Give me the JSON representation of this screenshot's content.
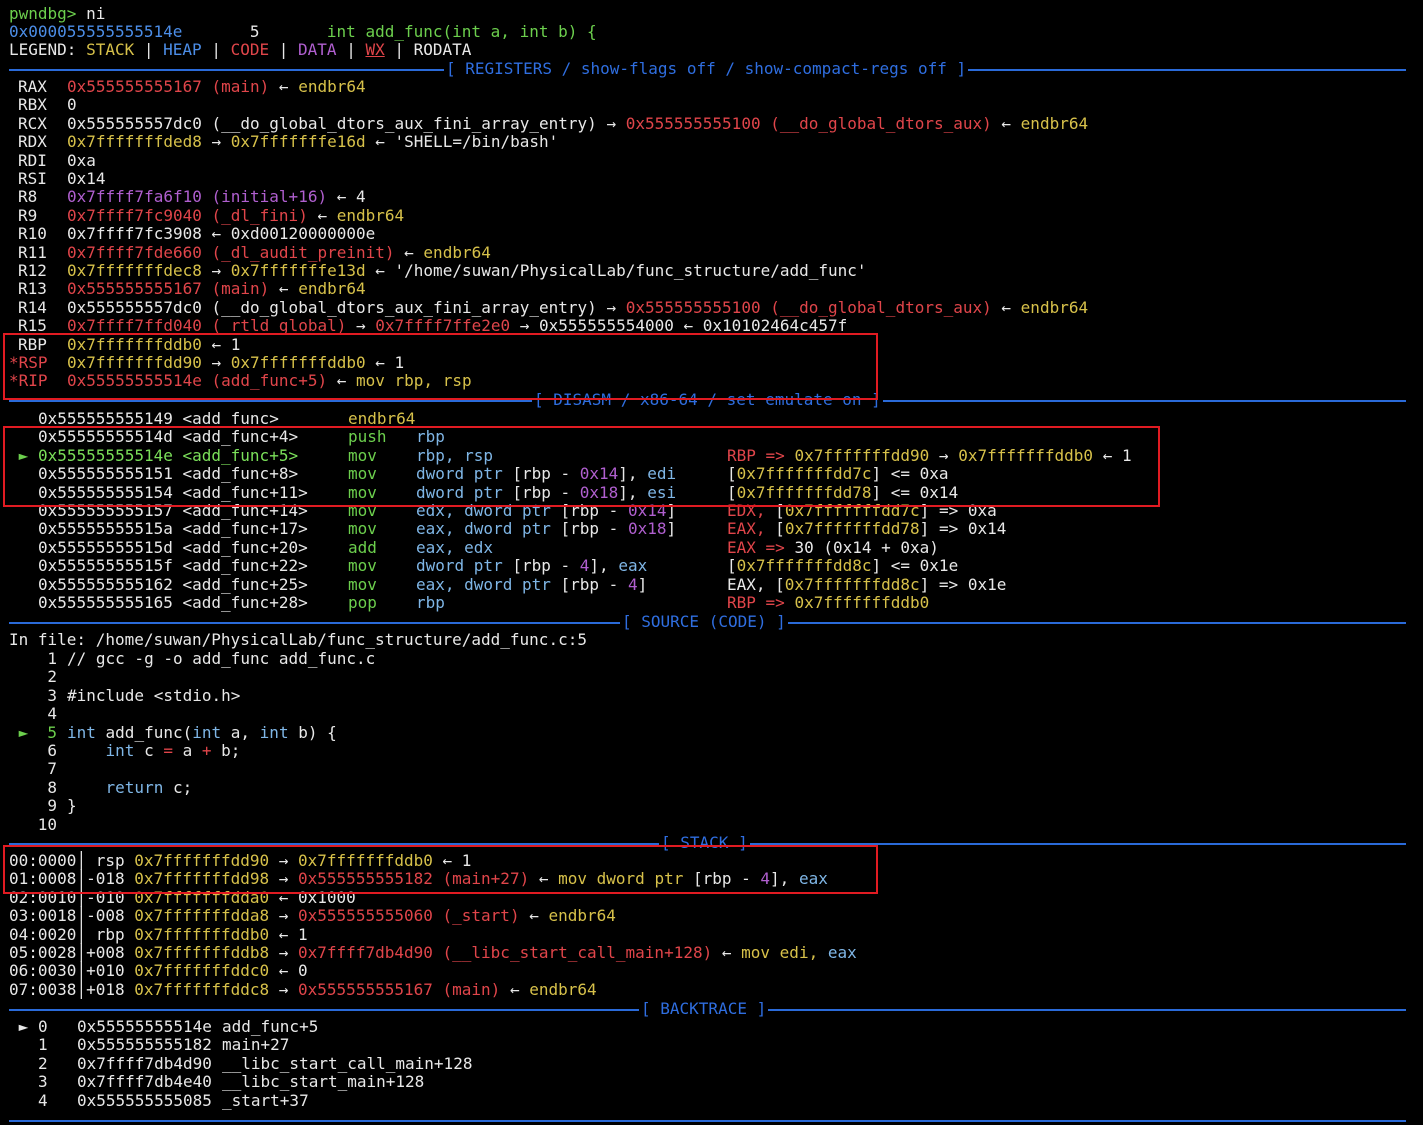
{
  "prompt": {
    "name": "pwndbg>",
    "command": "ni"
  },
  "ctx_line": {
    "addr": "0x000055555555514e",
    "line_no": "5",
    "src": "int add_func(int a, int b) {"
  },
  "legend": {
    "label": "LEGEND:",
    "items": [
      "STACK",
      "HEAP",
      "CODE",
      "DATA",
      "WX",
      "RODATA"
    ]
  },
  "sections": {
    "registers": "[ REGISTERS / show-flags off / show-compact-regs off ]",
    "disasm": "[ DISASM / x86-64 / set emulate on ]",
    "source": "[ SOURCE (CODE) ]",
    "stack": "[ STACK ]",
    "backtrace": "[ BACKTRACE ]"
  },
  "registers": [
    {
      "name": "RAX",
      "parts": [
        [
          "0x555555555167 (main)",
          "red"
        ],
        [
          " ← ",
          "white"
        ],
        [
          "endbr64",
          "yellow"
        ]
      ]
    },
    {
      "name": "RBX",
      "parts": [
        [
          "0",
          "white"
        ]
      ]
    },
    {
      "name": "RCX",
      "parts": [
        [
          "0x555555557dc0 (__do_global_dtors_aux_fini_array_entry)",
          "white"
        ],
        [
          " → ",
          "white"
        ],
        [
          "0x555555555100 (__do_global_dtors_aux)",
          "red"
        ],
        [
          " ← ",
          "white"
        ],
        [
          "endbr64",
          "yellow"
        ]
      ]
    },
    {
      "name": "RDX",
      "parts": [
        [
          "0x7fffffffded8",
          "yellow"
        ],
        [
          " → ",
          "white"
        ],
        [
          "0x7fffffffe16d",
          "yellow"
        ],
        [
          " ← 'SHELL=/bin/bash'",
          "white"
        ]
      ]
    },
    {
      "name": "RDI",
      "parts": [
        [
          "0xa",
          "white"
        ]
      ]
    },
    {
      "name": "RSI",
      "parts": [
        [
          "0x14",
          "white"
        ]
      ]
    },
    {
      "name": "R8",
      "parts": [
        [
          "0x7ffff7fa6f10 (initial+16)",
          "purple"
        ],
        [
          " ← 4",
          "white"
        ]
      ]
    },
    {
      "name": "R9",
      "parts": [
        [
          "0x7ffff7fc9040 (_dl_fini)",
          "red"
        ],
        [
          " ← ",
          "white"
        ],
        [
          "endbr64",
          "yellow"
        ]
      ]
    },
    {
      "name": "R10",
      "parts": [
        [
          "0x7ffff7fc3908 ← 0xd00120000000e",
          "white"
        ]
      ]
    },
    {
      "name": "R11",
      "parts": [
        [
          "0x7ffff7fde660 (_dl_audit_preinit)",
          "red"
        ],
        [
          " ← ",
          "white"
        ],
        [
          "endbr64",
          "yellow"
        ]
      ]
    },
    {
      "name": "R12",
      "parts": [
        [
          "0x7fffffffdec8",
          "yellow"
        ],
        [
          " → ",
          "white"
        ],
        [
          "0x7fffffffe13d",
          "yellow"
        ],
        [
          " ← '/home/suwan/PhysicalLab/func_structure/add_func'",
          "white"
        ]
      ]
    },
    {
      "name": "R13",
      "parts": [
        [
          "0x555555555167 (main)",
          "red"
        ],
        [
          " ← ",
          "white"
        ],
        [
          "endbr64",
          "yellow"
        ]
      ]
    },
    {
      "name": "R14",
      "parts": [
        [
          "0x555555557dc0 (__do_global_dtors_aux_fini_array_entry)",
          "white"
        ],
        [
          " → ",
          "white"
        ],
        [
          "0x555555555100 (__do_global_dtors_aux)",
          "red"
        ],
        [
          " ← ",
          "white"
        ],
        [
          "endbr64",
          "yellow"
        ]
      ]
    },
    {
      "name": "R15",
      "parts": [
        [
          "0x7ffff7ffd040 (_rtld_global)",
          "red"
        ],
        [
          " → ",
          "white"
        ],
        [
          "0x7ffff7ffe2e0",
          "red"
        ],
        [
          " → 0x555555554000 ← 0x10102464c457f",
          "white"
        ]
      ]
    },
    {
      "name": "RBP",
      "parts": [
        [
          "0x7fffffffddb0",
          "yellow"
        ],
        [
          " ← 1",
          "white"
        ]
      ]
    },
    {
      "name": "*RSP",
      "parts": [
        [
          "0x7fffffffdd90",
          "yellow"
        ],
        [
          " → ",
          "white"
        ],
        [
          "0x7fffffffddb0",
          "yellow"
        ],
        [
          " ← 1",
          "white"
        ]
      ]
    },
    {
      "name": "*RIP",
      "parts": [
        [
          "0x55555555514e (add_func+5)",
          "red"
        ],
        [
          " ← ",
          "white"
        ],
        [
          "mov rbp, rsp",
          "yellow"
        ]
      ]
    }
  ],
  "disasm": [
    {
      "cur": false,
      "addr": "0x555555555149 <add_func>",
      "mn": "endbr64",
      "ops": [],
      "cmt": []
    },
    {
      "cur": false,
      "addr": "0x55555555514d <add_func+4>",
      "mn": "push",
      "ops": [
        [
          "rbp",
          "cyan"
        ]
      ],
      "cmt": []
    },
    {
      "cur": true,
      "addr": "0x55555555514e <add_func+5>",
      "mn": "mov",
      "ops": [
        [
          "rbp, rsp",
          "cyan"
        ]
      ],
      "cmt": [
        [
          "RBP => ",
          "red"
        ],
        [
          "0x7fffffffdd90",
          "yellow"
        ],
        [
          " → ",
          "white"
        ],
        [
          "0x7fffffffddb0",
          "yellow"
        ],
        [
          " ← 1",
          "white"
        ]
      ]
    },
    {
      "cur": false,
      "addr": "0x555555555151 <add_func+8>",
      "mn": "mov",
      "ops": [
        [
          "dword ptr ",
          "cyan"
        ],
        [
          "[rbp - ",
          "white"
        ],
        [
          "0x14",
          "purple"
        ],
        [
          "], ",
          "white"
        ],
        [
          "edi",
          "cyan"
        ]
      ],
      "cmt": [
        [
          "[",
          "white"
        ],
        [
          "0x7fffffffdd7c",
          "yellow"
        ],
        [
          "] <= 0xa",
          "white"
        ]
      ]
    },
    {
      "cur": false,
      "addr": "0x555555555154 <add_func+11>",
      "mn": "mov",
      "ops": [
        [
          "dword ptr ",
          "cyan"
        ],
        [
          "[rbp - ",
          "white"
        ],
        [
          "0x18",
          "purple"
        ],
        [
          "], ",
          "white"
        ],
        [
          "esi",
          "cyan"
        ]
      ],
      "cmt": [
        [
          "[",
          "white"
        ],
        [
          "0x7fffffffdd78",
          "yellow"
        ],
        [
          "] <= 0x14",
          "white"
        ]
      ]
    },
    {
      "cur": false,
      "addr": "0x555555555157 <add_func+14>",
      "mn": "mov",
      "ops": [
        [
          "edx, dword ptr ",
          "cyan"
        ],
        [
          "[rbp - ",
          "white"
        ],
        [
          "0x14",
          "purple"
        ],
        [
          "]",
          "white"
        ]
      ],
      "cmt": [
        [
          "EDX, ",
          "red"
        ],
        [
          "[",
          "white"
        ],
        [
          "0x7fffffffdd7c",
          "yellow"
        ],
        [
          "] => 0xa",
          "white"
        ]
      ]
    },
    {
      "cur": false,
      "addr": "0x55555555515a <add_func+17>",
      "mn": "mov",
      "ops": [
        [
          "eax, dword ptr ",
          "cyan"
        ],
        [
          "[rbp - ",
          "white"
        ],
        [
          "0x18",
          "purple"
        ],
        [
          "]",
          "white"
        ]
      ],
      "cmt": [
        [
          "EAX, ",
          "red"
        ],
        [
          "[",
          "white"
        ],
        [
          "0x7fffffffdd78",
          "yellow"
        ],
        [
          "] => 0x14",
          "white"
        ]
      ]
    },
    {
      "cur": false,
      "addr": "0x55555555515d <add_func+20>",
      "mn": "add",
      "ops": [
        [
          "eax, edx",
          "cyan"
        ]
      ],
      "cmt": [
        [
          "EAX => ",
          "red"
        ],
        [
          "30 (0x14 + 0xa)",
          "white"
        ]
      ]
    },
    {
      "cur": false,
      "addr": "0x55555555515f <add_func+22>",
      "mn": "mov",
      "ops": [
        [
          "dword ptr ",
          "cyan"
        ],
        [
          "[rbp - ",
          "white"
        ],
        [
          "4",
          "purple"
        ],
        [
          "], ",
          "white"
        ],
        [
          "eax",
          "cyan"
        ]
      ],
      "cmt": [
        [
          "[",
          "white"
        ],
        [
          "0x7fffffffdd8c",
          "yellow"
        ],
        [
          "] <= 0x1e",
          "white"
        ]
      ]
    },
    {
      "cur": false,
      "addr": "0x555555555162 <add_func+25>",
      "mn": "mov",
      "ops": [
        [
          "eax, dword ptr ",
          "cyan"
        ],
        [
          "[rbp - ",
          "white"
        ],
        [
          "4",
          "purple"
        ],
        [
          "]",
          "white"
        ]
      ],
      "cmt": [
        [
          "EAX, [",
          "white"
        ],
        [
          "0x7fffffffdd8c",
          "yellow"
        ],
        [
          "] => 0x1e",
          "white"
        ]
      ]
    },
    {
      "cur": false,
      "addr": "0x555555555165 <add_func+28>",
      "mn": "pop",
      "ops": [
        [
          "rbp",
          "cyan"
        ]
      ],
      "cmt": [
        [
          "RBP => ",
          "red"
        ],
        [
          "0x7fffffffddb0",
          "yellow"
        ]
      ]
    }
  ],
  "source": {
    "file_line": "In file: /home/suwan/PhysicalLab/func_structure/add_func.c:5",
    "lines": [
      {
        "n": "1",
        "cur": false,
        "parts": [
          [
            "// gcc -g -o add_func add_func.c",
            "white"
          ]
        ]
      },
      {
        "n": "2",
        "cur": false,
        "parts": []
      },
      {
        "n": "3",
        "cur": false,
        "parts": [
          [
            "#include <stdio.h>",
            "white"
          ]
        ]
      },
      {
        "n": "4",
        "cur": false,
        "parts": []
      },
      {
        "n": "5",
        "cur": true,
        "parts": [
          [
            "int",
            "cyan"
          ],
          [
            " add_func(",
            "white"
          ],
          [
            "int",
            "cyan"
          ],
          [
            " a, ",
            "white"
          ],
          [
            "int",
            "cyan"
          ],
          [
            " b) {",
            "white"
          ]
        ]
      },
      {
        "n": "6",
        "cur": false,
        "parts": [
          [
            "    ",
            "white"
          ],
          [
            "int",
            "cyan"
          ],
          [
            " c ",
            "white"
          ],
          [
            "=",
            "red"
          ],
          [
            " a ",
            "white"
          ],
          [
            "+",
            "red"
          ],
          [
            " b;",
            "white"
          ]
        ]
      },
      {
        "n": "7",
        "cur": false,
        "parts": []
      },
      {
        "n": "8",
        "cur": false,
        "parts": [
          [
            "    ",
            "white"
          ],
          [
            "return",
            "cyan"
          ],
          [
            " c;",
            "white"
          ]
        ]
      },
      {
        "n": "9",
        "cur": false,
        "parts": [
          [
            "}",
            "white"
          ]
        ]
      },
      {
        "n": "10",
        "cur": false,
        "parts": []
      }
    ]
  },
  "stack": [
    {
      "idx": "00:0000",
      "off": " rsp",
      "parts": [
        [
          "0x7fffffffdd90",
          "yellow"
        ],
        [
          " → ",
          "white"
        ],
        [
          "0x7fffffffddb0",
          "yellow"
        ],
        [
          " ← 1",
          "white"
        ]
      ]
    },
    {
      "idx": "01:0008",
      "off": "-018",
      "parts": [
        [
          "0x7fffffffdd98",
          "yellow"
        ],
        [
          " → ",
          "white"
        ],
        [
          "0x555555555182 (main+27)",
          "red"
        ],
        [
          " ← ",
          "white"
        ],
        [
          "mov dword ptr ",
          "yellow"
        ],
        [
          "[rbp - ",
          "white"
        ],
        [
          "4",
          "purple"
        ],
        [
          "], ",
          "white"
        ],
        [
          "eax",
          "cyan"
        ]
      ]
    },
    {
      "idx": "02:0010",
      "off": "-010",
      "parts": [
        [
          "0x7fffffffdda0",
          "yellow"
        ],
        [
          " ← 0x1000",
          "white"
        ]
      ]
    },
    {
      "idx": "03:0018",
      "off": "-008",
      "parts": [
        [
          "0x7fffffffdda8",
          "yellow"
        ],
        [
          " → ",
          "white"
        ],
        [
          "0x555555555060 (_start)",
          "red"
        ],
        [
          " ← ",
          "white"
        ],
        [
          "endbr64",
          "yellow"
        ]
      ]
    },
    {
      "idx": "04:0020",
      "off": " rbp",
      "parts": [
        [
          "0x7fffffffddb0",
          "yellow"
        ],
        [
          " ← 1",
          "white"
        ]
      ]
    },
    {
      "idx": "05:0028",
      "off": "+008",
      "parts": [
        [
          "0x7fffffffddb8",
          "yellow"
        ],
        [
          " → ",
          "white"
        ],
        [
          "0x7ffff7db4d90 (__libc_start_call_main+128)",
          "red"
        ],
        [
          " ← ",
          "white"
        ],
        [
          "mov edi, ",
          "yellow"
        ],
        [
          "eax",
          "cyan"
        ]
      ]
    },
    {
      "idx": "06:0030",
      "off": "+010",
      "parts": [
        [
          "0x7fffffffddc0",
          "yellow"
        ],
        [
          " ← 0",
          "white"
        ]
      ]
    },
    {
      "idx": "07:0038",
      "off": "+018",
      "parts": [
        [
          "0x7fffffffddc8",
          "yellow"
        ],
        [
          " → ",
          "white"
        ],
        [
          "0x555555555167 (main)",
          "red"
        ],
        [
          " ← ",
          "white"
        ],
        [
          "endbr64",
          "yellow"
        ]
      ]
    }
  ],
  "backtrace": [
    {
      "n": "0",
      "cur": true,
      "addr": "0x55555555514e",
      "sym": "add_func+5"
    },
    {
      "n": "1",
      "cur": false,
      "addr": "0x555555555182",
      "sym": "main+27"
    },
    {
      "n": "2",
      "cur": false,
      "addr": "0x7ffff7db4d90",
      "sym": "__libc_start_call_main+128"
    },
    {
      "n": "3",
      "cur": false,
      "addr": "0x7ffff7db4e40",
      "sym": "__libc_start_main+128"
    },
    {
      "n": "4",
      "cur": false,
      "addr": "0x555555555085",
      "sym": "_start+37"
    }
  ],
  "colors": {
    "accent": "#2a6ad8",
    "highlight": "#e11b22"
  }
}
